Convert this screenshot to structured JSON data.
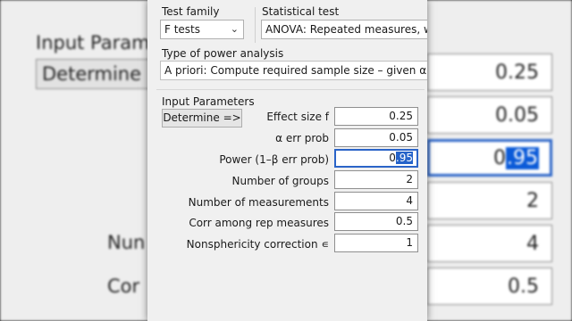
{
  "background": {
    "heading": "Input Param",
    "determine_label": "Determine",
    "label_number": "Nun",
    "label_corr": "Cor",
    "values": [
      "0.25",
      "0.05",
      "0.95",
      "2",
      "4",
      "0.5"
    ],
    "power_value_prefix": "0",
    "power_value_selected": ".95"
  },
  "dialog": {
    "test_family_label": "Test family",
    "test_family_value": "F tests",
    "statistical_test_label": "Statistical test",
    "statistical_test_value": "ANOVA: Repeated measures, wi",
    "analysis_type_label": "Type of power analysis",
    "analysis_type_value": "A priori: Compute required sample size – given α, p",
    "input_params_label": "Input Parameters",
    "determine_button": "Determine =>",
    "params": [
      {
        "label": "Effect size f",
        "value": "0.25"
      },
      {
        "label": "α err prob",
        "value": "0.05"
      },
      {
        "label": "Power (1–β err prob)",
        "value": "0.95",
        "value_prefix": "0",
        "value_selected": ".95"
      },
      {
        "label": "Number of groups",
        "value": "2"
      },
      {
        "label": "Number of measurements",
        "value": "4"
      },
      {
        "label": "Corr among rep measures",
        "value": "0.5"
      },
      {
        "label": "Nonsphericity correction ∊",
        "value": "1"
      }
    ]
  },
  "icons": {
    "dropdown": "chevron-down-icon"
  },
  "colors": {
    "selection": "#2563c9",
    "dialog_bg": "#f0f0f0",
    "focus_border": "#2a64c8"
  }
}
